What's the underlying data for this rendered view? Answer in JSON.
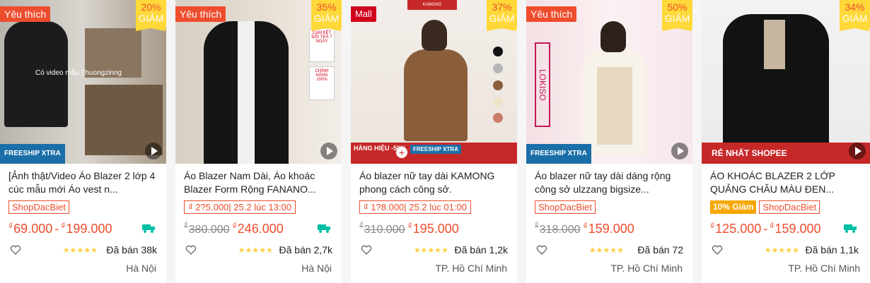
{
  "colors": {
    "accent": "#ee4d2d",
    "star": "#ffce3d",
    "discount_bg": "#ffd839",
    "mall": "#d0011b"
  },
  "products": [
    {
      "badge": "Yêu thích",
      "discount_pct": "20%",
      "discount_label": "GIẢM",
      "image_caption": "Có video mẫu Thuongzinng",
      "image_banner": "FREESHIP XTRA",
      "title": "[Ảnh thật/Video Áo Blazer 2 lớp 4 cúc mẫu mới Áo vest n...",
      "promo_label": "ShopDacBiet",
      "currency": "₫",
      "price_min": "69.000",
      "price_max": "199.000",
      "old_price": "",
      "price": "",
      "free_ship_icon": "free-shipping-truck-icon",
      "sold": "Đã bán 38k",
      "location": "Hà Nội",
      "rating_stars": 5
    },
    {
      "badge": "Yêu thích",
      "discount_pct": "35%",
      "discount_label": "GIẢM",
      "side_badges": [
        "CAM KẾT ĐỔI TRẢ 7 NGÀY",
        "CHÍNH HÃNG 100%"
      ],
      "title": "Áo Blazer Nam Dài, Áo khoác Blazer Form Rộng FANANO...",
      "promo_label": "₫ 2?5.000| 25.2 lúc 13:00",
      "currency": "₫",
      "old_price": "380.000",
      "price": "246.000",
      "free_ship_icon": "free-shipping-truck-icon",
      "sold": "Đã bán 2,7k",
      "location": "Hà Nội",
      "rating_stars": 5
    },
    {
      "badge": "Mall",
      "discount_pct": "37%",
      "discount_label": "GIẢM",
      "image_brand": "KAMONG",
      "image_banner_left": "HÀNG HIỆU -50%",
      "image_banner_right": "FREESHIP XTRA",
      "title": "Áo blazer nữ tay dài KAMONG phong cách công sở.",
      "promo_label": "₫ 1?8.000| 25.2 lúc 01:00",
      "currency": "₫",
      "old_price": "310.000",
      "price": "195.000",
      "sold": "Đã bán 1,2k",
      "location": "TP. Hồ Chí Minh",
      "rating_stars": 5
    },
    {
      "badge": "Yêu thích",
      "discount_pct": "50%",
      "discount_label": "GIẢM",
      "image_brand": "LOKISO",
      "image_banner": "FREESHIP XTRA",
      "title": "Áo blazer nữ tay dài dáng rộng công sở ulzzang bigsize...",
      "promo_label": "ShopDacBiet",
      "currency": "₫",
      "old_price": "318.000",
      "price": "159.000",
      "sold": "Đã bán 72",
      "location": "TP. Hồ Chí Minh",
      "rating_stars": 5
    },
    {
      "badge": "",
      "discount_pct": "34%",
      "discount_label": "GIẢM",
      "image_banner": "RẺ NHẤT SHOPEE",
      "title": "ÁO KHOÁC BLAZER 2 LỚP QUẢNG CHÂU MÀU ĐEN...",
      "voucher": "10% Giảm",
      "promo_label": "ShopDacBiet",
      "currency": "₫",
      "price_min": "125.000",
      "price_max": "159.000",
      "free_ship_icon": "free-shipping-truck-icon",
      "sold": "Đã bán 1,1k",
      "location": "TP. Hồ Chí Minh",
      "rating_stars": 5
    }
  ]
}
